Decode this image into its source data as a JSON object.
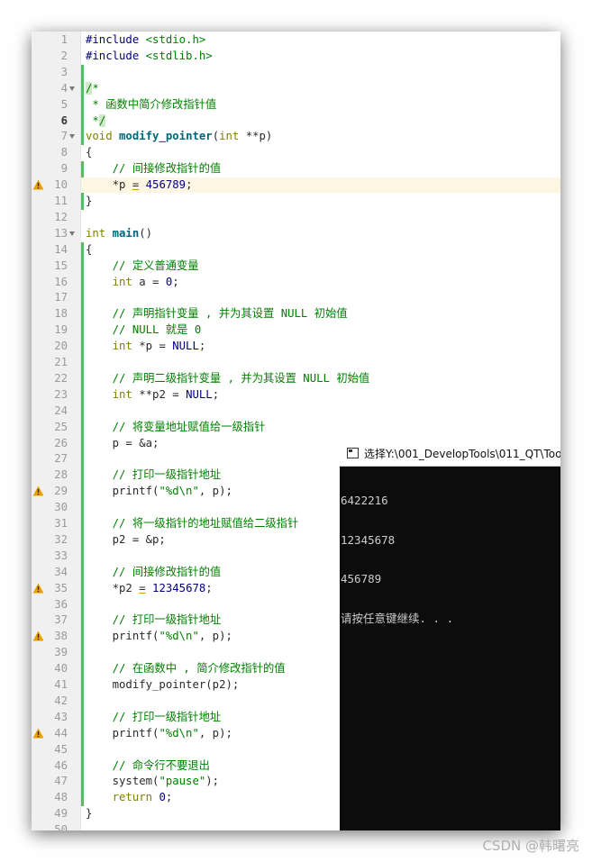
{
  "editor": {
    "lines": [
      {
        "n": "1",
        "segs": [
          [
            "pp",
            "#include "
          ],
          [
            "str",
            "<stdio.h>"
          ]
        ]
      },
      {
        "n": "2",
        "segs": [
          [
            "pp",
            "#include "
          ],
          [
            "str",
            "<stdlib.h>"
          ]
        ]
      },
      {
        "n": "3",
        "segs": []
      },
      {
        "n": "4",
        "fold": true,
        "segs": [
          [
            "cm sel",
            "/"
          ],
          [
            "cm",
            "*"
          ]
        ]
      },
      {
        "n": "5",
        "segs": [
          [
            "cm",
            " * 函数中简介修改指针值"
          ]
        ]
      },
      {
        "n": "6",
        "bold": true,
        "segs": [
          [
            "cm",
            " *"
          ],
          [
            "cm sel",
            "/"
          ]
        ]
      },
      {
        "n": "7",
        "fold": true,
        "segs": [
          [
            "kw",
            "void "
          ],
          [
            "fn",
            "modify_pointer"
          ],
          [
            "",
            "("
          ],
          [
            "kw",
            "int"
          ],
          [
            "",
            " **p)"
          ]
        ]
      },
      {
        "n": "8",
        "segs": [
          [
            "",
            "{"
          ]
        ]
      },
      {
        "n": "9",
        "segs": [
          [
            "cm",
            "    // 间接修改指针的值"
          ]
        ]
      },
      {
        "n": "10",
        "warn": true,
        "hl": true,
        "segs": [
          [
            "",
            "    *p "
          ],
          [
            "uline",
            "="
          ],
          [
            "",
            " "
          ],
          [
            "num",
            "456789"
          ],
          [
            "",
            ";"
          ]
        ]
      },
      {
        "n": "11",
        "segs": [
          [
            "",
            "}"
          ]
        ]
      },
      {
        "n": "12",
        "segs": []
      },
      {
        "n": "13",
        "fold": true,
        "segs": [
          [
            "kw",
            "int "
          ],
          [
            "fn",
            "main"
          ],
          [
            "",
            "()"
          ]
        ]
      },
      {
        "n": "14",
        "segs": [
          [
            "",
            "{"
          ]
        ]
      },
      {
        "n": "15",
        "segs": [
          [
            "cm",
            "    // 定义普通变量"
          ]
        ]
      },
      {
        "n": "16",
        "segs": [
          [
            "kw",
            "    int"
          ],
          [
            "",
            " a = "
          ],
          [
            "num",
            "0"
          ],
          [
            "",
            ";"
          ]
        ]
      },
      {
        "n": "17",
        "segs": []
      },
      {
        "n": "18",
        "segs": [
          [
            "cm",
            "    // 声明指针变量 , 并为其设置 NULL 初始值"
          ]
        ]
      },
      {
        "n": "19",
        "segs": [
          [
            "cm",
            "    // NULL 就是 0"
          ]
        ]
      },
      {
        "n": "20",
        "segs": [
          [
            "kw",
            "    int"
          ],
          [
            "",
            " *p = "
          ],
          [
            "mc",
            "NULL"
          ],
          [
            "",
            ";"
          ]
        ]
      },
      {
        "n": "21",
        "segs": []
      },
      {
        "n": "22",
        "segs": [
          [
            "cm",
            "    // 声明二级指针变量 , 并为其设置 NULL 初始值"
          ]
        ]
      },
      {
        "n": "23",
        "segs": [
          [
            "kw",
            "    int"
          ],
          [
            "",
            " **p2 = "
          ],
          [
            "mc",
            "NULL"
          ],
          [
            "",
            ";"
          ]
        ]
      },
      {
        "n": "24",
        "segs": []
      },
      {
        "n": "25",
        "segs": [
          [
            "cm",
            "    // 将变量地址赋值给一级指针"
          ]
        ]
      },
      {
        "n": "26",
        "segs": [
          [
            "",
            "    p = &a;"
          ]
        ]
      },
      {
        "n": "27",
        "segs": []
      },
      {
        "n": "28",
        "segs": [
          [
            "cm",
            "    // 打印一级指针地址"
          ]
        ]
      },
      {
        "n": "29",
        "warn": true,
        "segs": [
          [
            "",
            "    printf("
          ],
          [
            "str",
            "\"%d\\n\""
          ],
          [
            "",
            ", p);"
          ]
        ]
      },
      {
        "n": "30",
        "segs": []
      },
      {
        "n": "31",
        "segs": [
          [
            "cm",
            "    // 将一级指针的地址赋值给二级指针"
          ]
        ]
      },
      {
        "n": "32",
        "segs": [
          [
            "",
            "    p2 = &p;"
          ]
        ]
      },
      {
        "n": "33",
        "segs": []
      },
      {
        "n": "34",
        "segs": [
          [
            "cm",
            "    // 间接修改指针的值"
          ]
        ]
      },
      {
        "n": "35",
        "warn": true,
        "segs": [
          [
            "",
            "    *p2 "
          ],
          [
            "uline",
            "="
          ],
          [
            "",
            " "
          ],
          [
            "num",
            "12345678"
          ],
          [
            "",
            ";"
          ]
        ]
      },
      {
        "n": "36",
        "segs": []
      },
      {
        "n": "37",
        "segs": [
          [
            "cm",
            "    // 打印一级指针地址"
          ]
        ]
      },
      {
        "n": "38",
        "warn": true,
        "segs": [
          [
            "",
            "    printf("
          ],
          [
            "str",
            "\"%d\\n\""
          ],
          [
            "",
            ", p);"
          ]
        ]
      },
      {
        "n": "39",
        "segs": []
      },
      {
        "n": "40",
        "segs": [
          [
            "cm",
            "    // 在函数中 , 简介修改指针的值"
          ]
        ]
      },
      {
        "n": "41",
        "segs": [
          [
            "",
            "    modify_pointer(p2);"
          ]
        ]
      },
      {
        "n": "42",
        "segs": []
      },
      {
        "n": "43",
        "segs": [
          [
            "cm",
            "    // 打印一级指针地址"
          ]
        ]
      },
      {
        "n": "44",
        "warn": true,
        "segs": [
          [
            "",
            "    printf("
          ],
          [
            "str",
            "\"%d\\n\""
          ],
          [
            "",
            ", p);"
          ]
        ]
      },
      {
        "n": "45",
        "segs": []
      },
      {
        "n": "46",
        "segs": [
          [
            "cm",
            "    // 命令行不要退出"
          ]
        ]
      },
      {
        "n": "47",
        "segs": [
          [
            "",
            "    system("
          ],
          [
            "str",
            "\"pause\""
          ],
          [
            "",
            ");"
          ]
        ]
      },
      {
        "n": "48",
        "segs": [
          [
            "kw",
            "    return "
          ],
          [
            "num",
            "0"
          ],
          [
            "",
            ";"
          ]
        ]
      },
      {
        "n": "49",
        "segs": [
          [
            "",
            "}"
          ]
        ]
      },
      {
        "n": "50",
        "segs": []
      }
    ],
    "modified_ranges": [
      [
        3,
        7
      ],
      [
        9,
        11
      ],
      [
        14,
        48
      ]
    ]
  },
  "console": {
    "title": "选择Y:\\001_DevelopTools\\011_QT\\Too",
    "output": [
      "6422216",
      "12345678",
      "456789",
      "请按任意键继续. . ."
    ]
  },
  "watermark": "CSDN @韩曙亮",
  "colors": {
    "keyword": "#808000",
    "function": "#00677c",
    "comment": "#008000",
    "number": "#000080",
    "warning": "#e8a000"
  }
}
